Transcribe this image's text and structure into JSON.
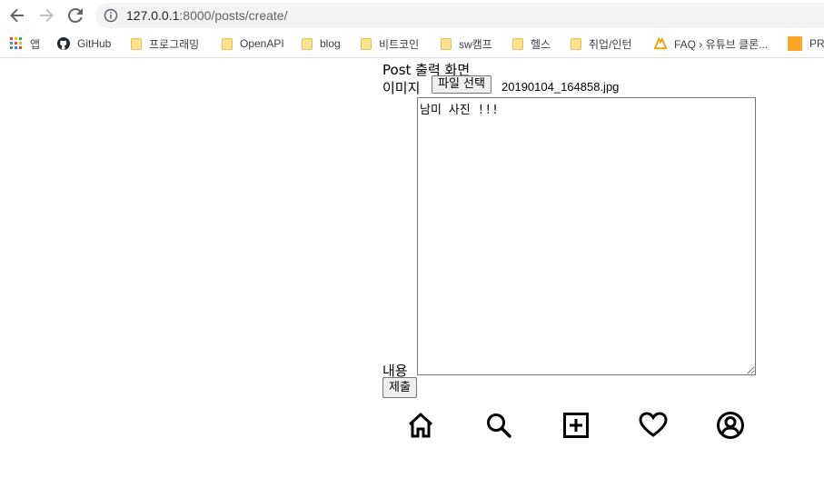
{
  "browser": {
    "url_host": "127.0.0.1",
    "url_path": ":8000/posts/create/",
    "bookmarks": [
      {
        "label": "앱",
        "icon": "apps-grid-icon"
      },
      {
        "label": "GitHub",
        "icon": "github-icon"
      },
      {
        "label": "프로그래밍",
        "icon": "folder-icon"
      },
      {
        "label": "OpenAPI",
        "icon": "folder-icon"
      },
      {
        "label": "blog",
        "icon": "folder-icon"
      },
      {
        "label": "비트코인",
        "icon": "folder-icon"
      },
      {
        "label": "sw캠프",
        "icon": "folder-icon"
      },
      {
        "label": "헬스",
        "icon": "folder-icon"
      },
      {
        "label": "취업/인턴",
        "icon": "folder-icon"
      },
      {
        "label": "FAQ › 유튜브 클론...",
        "icon": "faq-logo-icon"
      },
      {
        "label": "PR",
        "icon": "orange-square-icon"
      }
    ]
  },
  "page": {
    "heading": "Post 출력 화면",
    "image_label": "이미지",
    "file_button_label": "파일 선택",
    "file_name": "20190104_164858.jpg",
    "content_label": "내용",
    "content_value": "남미 사진 !!!",
    "submit_label": "제출"
  },
  "bottom_nav": [
    {
      "name": "home-icon"
    },
    {
      "name": "search-icon"
    },
    {
      "name": "add-post-icon"
    },
    {
      "name": "heart-icon"
    },
    {
      "name": "profile-icon"
    }
  ]
}
